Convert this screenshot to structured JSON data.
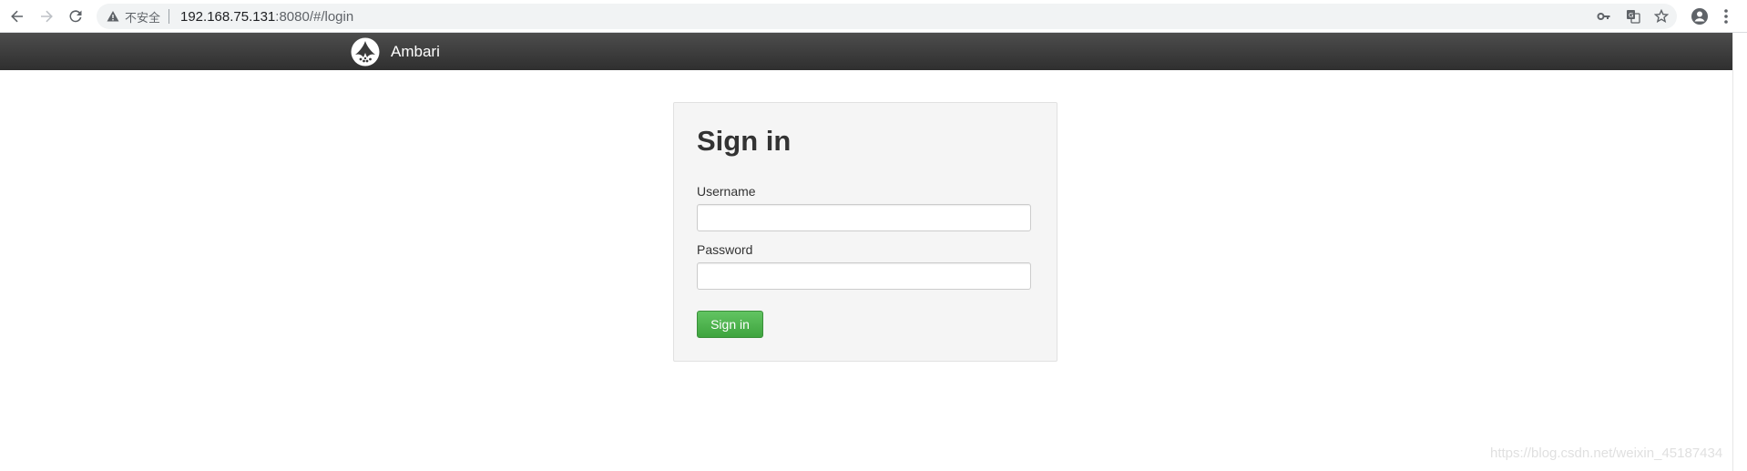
{
  "browser": {
    "security_label": "不安全",
    "url_host": "192.168.75.131",
    "url_rest": ":8080/#/login",
    "icons": [
      "back-icon",
      "forward-icon",
      "reload-icon",
      "warning-icon",
      "key-icon",
      "translate-icon",
      "star-icon",
      "account-icon",
      "menu-icon"
    ]
  },
  "navbar": {
    "brand_name": "Ambari",
    "background": "#333333"
  },
  "login": {
    "title": "Sign in",
    "username_label": "Username",
    "username_value": "",
    "password_label": "Password",
    "password_value": "",
    "submit_label": "Sign in",
    "button_color": "#51a351"
  },
  "watermark": "https://blog.csdn.net/weixin_45187434"
}
